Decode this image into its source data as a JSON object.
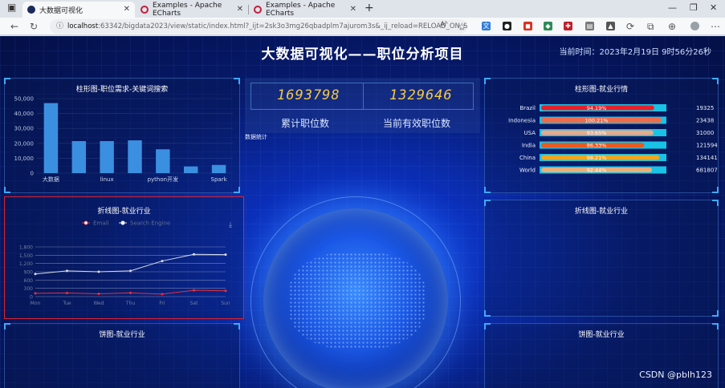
{
  "browser": {
    "tabs": [
      {
        "title": "大数据可视化",
        "active": true
      },
      {
        "title": "Examples - Apache ECharts",
        "active": false
      },
      {
        "title": "Examples - Apache ECharts",
        "active": false
      }
    ],
    "url_host": "localhost",
    "url_path": ":63342/bigdata2023/view/static/index.html?_ijt=2sk3o3mg26qbadplm7ajurom3s&_ij_reload=RELOAD_ON_SAVE",
    "reader_label": "Aʰ"
  },
  "header": {
    "title": "大数据可视化——职位分析项目",
    "time": "当前时间：2023年2月19日 9时56分26秒"
  },
  "counters": {
    "total_value": "1693798",
    "total_label": "累计职位数",
    "active_value": "1329646",
    "active_label": "当前有效职位数",
    "note": "数据统计"
  },
  "panels": {
    "top_left": "柱形图-职位需求-关键词搜索",
    "mid_left": "折线图-就业行业",
    "bottom_left": "饼图-就业行业",
    "top_right": "柱形图-就业行情",
    "mid_right": "折线图-就业行业",
    "bottom_right": "饼图-就业行业"
  },
  "watermark": "CSDN @pblh123",
  "chart_data": [
    {
      "type": "bar",
      "categories": [
        "大数据",
        "",
        "linux",
        "",
        "python开发",
        "",
        "Spark"
      ],
      "values": [
        47000,
        21500,
        21500,
        22000,
        16000,
        4500,
        5500
      ],
      "ylim": [
        0,
        50000
      ],
      "yticks": [
        "0",
        "10,000",
        "20,000",
        "30,000",
        "40,000",
        "50,000"
      ],
      "color": "#3b8fe0"
    },
    {
      "type": "line",
      "legend": [
        "Email",
        "Search Engine"
      ],
      "categories": [
        "Mon",
        "Tue",
        "Wed",
        "Thu",
        "Fri",
        "Sat",
        "Sun"
      ],
      "ylim": [
        0,
        1800
      ],
      "yticks": [
        "0",
        "300",
        "600",
        "900",
        "1,200",
        "1,500",
        "1,800"
      ],
      "series": [
        {
          "name": "Email",
          "values": [
            120,
            132,
            101,
            134,
            90,
            230,
            210
          ],
          "color": "#e8313a"
        },
        {
          "name": "Search Engine",
          "values": [
            820,
            932,
            901,
            934,
            1290,
            1530,
            1520
          ],
          "color": "#d6dde8"
        }
      ]
    },
    {
      "type": "bar",
      "orientation": "horizontal",
      "categories": [
        "Brazil",
        "Indonesia",
        "USA",
        "India",
        "China",
        "World"
      ],
      "percents": [
        "94.19%",
        "100.21%",
        "93.65%",
        "86.33%",
        "98.21%",
        "92.44%"
      ],
      "values": [
        94.19,
        100.21,
        93.65,
        86.33,
        98.21,
        92.44
      ],
      "totals": [
        "19325",
        "23438",
        "31000",
        "121594",
        "134141",
        "681807"
      ],
      "colors": [
        "#e8202a",
        "#ef6b4a",
        "#e9a98a",
        "#ea5a1e",
        "#f2a51f",
        "#e8b07a"
      ],
      "track_color": "#18c3e6"
    }
  ]
}
